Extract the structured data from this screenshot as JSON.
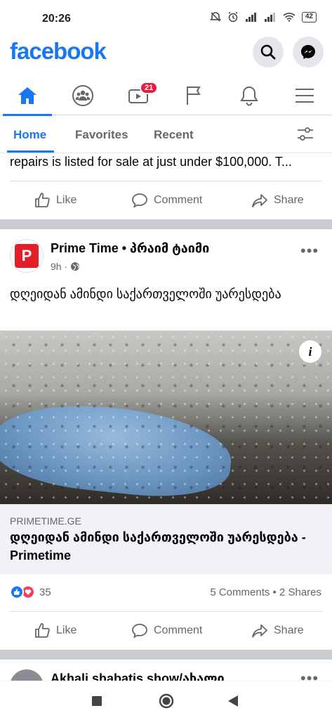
{
  "status_bar": {
    "time": "20:26",
    "battery": "42"
  },
  "header": {
    "logo": "facebook"
  },
  "nav": {
    "video_badge": "21"
  },
  "tabs": {
    "home": "Home",
    "favorites": "Favorites",
    "recent": "Recent"
  },
  "previous_post": {
    "text": "repairs is listed for sale at just under $100,000. T...",
    "actions": {
      "like": "Like",
      "comment": "Comment",
      "share": "Share"
    }
  },
  "post": {
    "page_name": "Prime Time • პრაიმ ტაიმი",
    "time": "9h ·",
    "text": "დღეიდან ამინდი საქართველოში უარესდება",
    "link": {
      "domain": "PRIMETIME.GE",
      "title": "დღეიდან ამინდი საქართველოში უარესდება - Primetime"
    },
    "reaction_count": "35",
    "stats": "5 Comments • 2 Shares",
    "actions": {
      "like": "Like",
      "comment": "Comment",
      "share": "Share"
    }
  },
  "next_post": {
    "page_name": "Akhali shabatis show/ახალი"
  },
  "colors": {
    "brand": "#1877f2",
    "badge": "#e41e3f",
    "separator": "#c9ccd1"
  }
}
